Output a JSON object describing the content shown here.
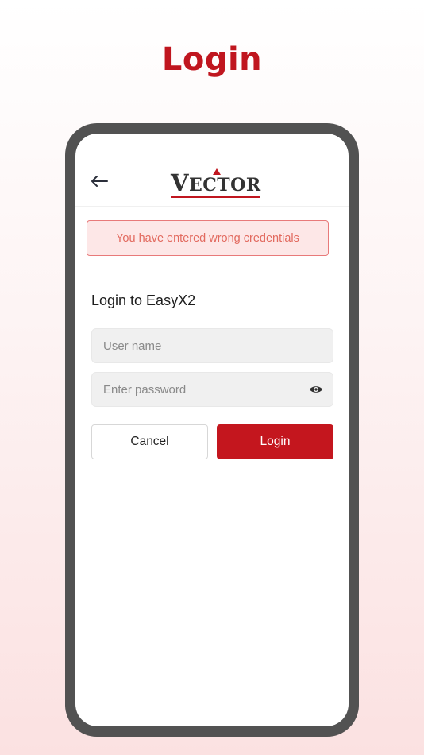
{
  "page": {
    "title": "Login"
  },
  "header": {
    "back_icon": "arrow-left-icon",
    "logo": {
      "first_letter": "V",
      "rest": "ECTOR",
      "accent_color": "#c0161f"
    }
  },
  "alert": {
    "message": "You have entered wrong credentials"
  },
  "form": {
    "heading": "Login to EasyX2",
    "username": {
      "value": "",
      "placeholder": "User name"
    },
    "password": {
      "value": "",
      "placeholder": "Enter password",
      "toggle_icon": "eye-icon"
    }
  },
  "buttons": {
    "cancel_label": "Cancel",
    "login_label": "Login"
  },
  "colors": {
    "brand_red": "#c4161e",
    "alert_text": "#e26a5f",
    "alert_bg": "#fde7e7"
  }
}
